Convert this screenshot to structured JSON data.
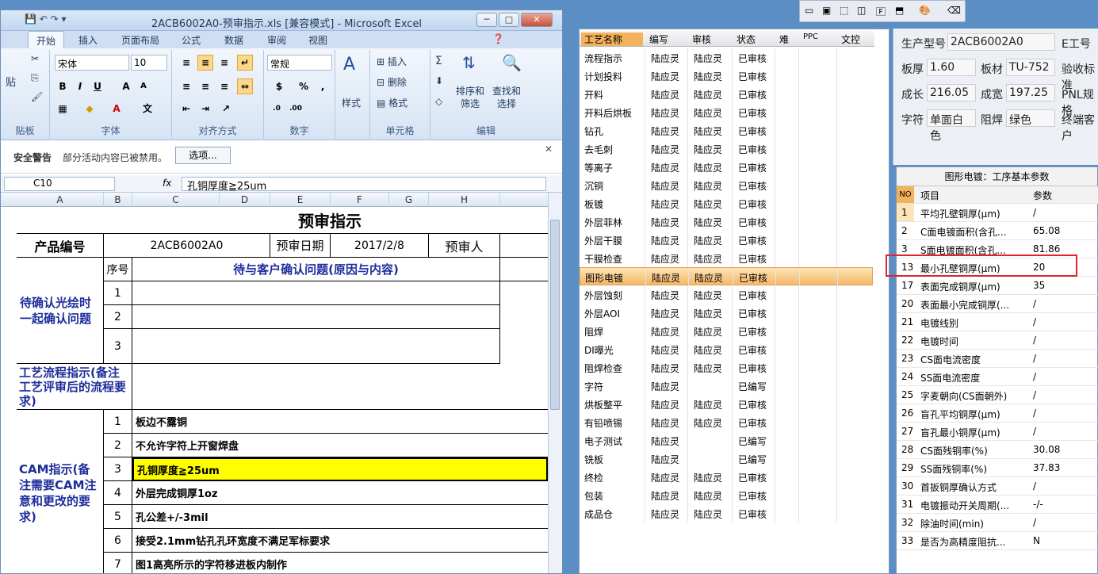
{
  "excel": {
    "title": "2ACB6002A0-预审指示.xls  [兼容模式] - Microsoft Excel",
    "tabs": [
      "开始",
      "插入",
      "页面布局",
      "公式",
      "数据",
      "审阅",
      "视图"
    ],
    "ribbon": {
      "font_name": "宋体",
      "font_size": "10",
      "number_format": "常规",
      "paste": "贴",
      "group_clipboard": "贴板",
      "group_font": "字体",
      "group_align": "对齐方式",
      "group_number": "数字",
      "styles": "样式",
      "insert": "插入",
      "delete": "删除",
      "format": "格式",
      "group_cells": "单元格",
      "sort_filter": "排序和\n筛选",
      "find_select": "查找和\n选择",
      "group_edit": "编辑"
    },
    "security": {
      "title": "安全警告",
      "message": "部分活动内容已被禁用。",
      "options": "选项..."
    },
    "formula": {
      "cell_ref": "C10",
      "fx": "fx",
      "content": "孔铜厚度≧25um"
    },
    "columns": [
      "A",
      "B",
      "C",
      "D",
      "E",
      "F",
      "G",
      "H"
    ],
    "sheet": {
      "title": "预审指示",
      "product_no_label": "产品编号",
      "product_no": "2ACB6002A0",
      "review_date_label": "预审日期",
      "review_date": "2017/2/8",
      "reviewer_label": "预审人",
      "seq_label": "序号",
      "pending_header": "待与客户确认问题(原因与内容)",
      "pending_label": "待确认光绘时一起确认问题",
      "pending_rows": [
        "1",
        "2",
        "3"
      ],
      "process_label": "工艺流程指示(备注工艺评审后的流程要求)",
      "cam_label": "CAM指示(备注需要CAM注意和更改的要求)",
      "cam_rows": [
        {
          "no": "1",
          "text": "板边不露铜"
        },
        {
          "no": "2",
          "text": "不允许字符上开窗焊盘"
        },
        {
          "no": "3",
          "text": "孔铜厚度≧25um"
        },
        {
          "no": "4",
          "text": "外层完成铜厚1oz"
        },
        {
          "no": "5",
          "text": "孔公差+/-3mil"
        },
        {
          "no": "6",
          "text": "接受2.1mm钻孔孔环宽度不满足军标要求"
        },
        {
          "no": "7",
          "text": "图1高亮所示的字符移进板内制作"
        }
      ]
    }
  },
  "process_list": {
    "headers": [
      "工艺名称",
      "编写",
      "审核",
      "状态",
      "难",
      "PPC",
      "文控"
    ],
    "rows": [
      {
        "name": "流程指示",
        "writer": "陆应灵",
        "reviewer": "陆应灵",
        "status": "已审核"
      },
      {
        "name": "计划投料",
        "writer": "陆应灵",
        "reviewer": "陆应灵",
        "status": "已审核"
      },
      {
        "name": "开料",
        "writer": "陆应灵",
        "reviewer": "陆应灵",
        "status": "已审核"
      },
      {
        "name": "开料后烘板",
        "writer": "陆应灵",
        "reviewer": "陆应灵",
        "status": "已审核"
      },
      {
        "name": "钻孔",
        "writer": "陆应灵",
        "reviewer": "陆应灵",
        "status": "已审核"
      },
      {
        "name": "去毛刺",
        "writer": "陆应灵",
        "reviewer": "陆应灵",
        "status": "已审核"
      },
      {
        "name": "等离子",
        "writer": "陆应灵",
        "reviewer": "陆应灵",
        "status": "已审核"
      },
      {
        "name": "沉铜",
        "writer": "陆应灵",
        "reviewer": "陆应灵",
        "status": "已审核"
      },
      {
        "name": "板镀",
        "writer": "陆应灵",
        "reviewer": "陆应灵",
        "status": "已审核"
      },
      {
        "name": "外层菲林",
        "writer": "陆应灵",
        "reviewer": "陆应灵",
        "status": "已审核"
      },
      {
        "name": "外层干膜",
        "writer": "陆应灵",
        "reviewer": "陆应灵",
        "status": "已审核"
      },
      {
        "name": "干膜检查",
        "writer": "陆应灵",
        "reviewer": "陆应灵",
        "status": "已审核"
      },
      {
        "name": "图形电镀",
        "writer": "陆应灵",
        "reviewer": "陆应灵",
        "status": "已审核"
      },
      {
        "name": "外层蚀刻",
        "writer": "陆应灵",
        "reviewer": "陆应灵",
        "status": "已审核"
      },
      {
        "name": "外层AOI",
        "writer": "陆应灵",
        "reviewer": "陆应灵",
        "status": "已审核"
      },
      {
        "name": "阻焊",
        "writer": "陆应灵",
        "reviewer": "陆应灵",
        "status": "已审核"
      },
      {
        "name": "DI曝光",
        "writer": "陆应灵",
        "reviewer": "陆应灵",
        "status": "已审核"
      },
      {
        "name": "阻焊检查",
        "writer": "陆应灵",
        "reviewer": "陆应灵",
        "status": "已审核"
      },
      {
        "name": "字符",
        "writer": "陆应灵",
        "reviewer": "",
        "status": "已编写"
      },
      {
        "name": "烘板整平",
        "writer": "陆应灵",
        "reviewer": "陆应灵",
        "status": "已审核"
      },
      {
        "name": "有铅喷锡",
        "writer": "陆应灵",
        "reviewer": "陆应灵",
        "status": "已审核"
      },
      {
        "name": "电子测试",
        "writer": "陆应灵",
        "reviewer": "",
        "status": "已编写"
      },
      {
        "name": "铣板",
        "writer": "陆应灵",
        "reviewer": "",
        "status": "已编写"
      },
      {
        "name": "终检",
        "writer": "陆应灵",
        "reviewer": "陆应灵",
        "status": "已审核"
      },
      {
        "name": "包装",
        "writer": "陆应灵",
        "reviewer": "陆应灵",
        "status": "已审核"
      },
      {
        "name": "成品仓",
        "writer": "陆应灵",
        "reviewer": "陆应灵",
        "status": "已审核"
      }
    ]
  },
  "info": {
    "model_label": "生产型号",
    "model": "2ACB6002A0",
    "eno_label": "E工号",
    "thickness_label": "板厚",
    "thickness": "1.60",
    "material_label": "板材",
    "material": "TU-752",
    "accept_label": "验收标准",
    "length_label": "成长",
    "length": "216.05",
    "width_label": "成宽",
    "width": "197.25",
    "pnl_label": "PNL规格",
    "char_label": "字符",
    "char": "单面白色",
    "mask_label": "阻焊",
    "mask": "绿色",
    "terminal_label": "终端客户"
  },
  "params": {
    "title": "图形电镀：工序基本参数",
    "headers": [
      "NO",
      "项目",
      "参数"
    ],
    "rows": [
      {
        "no": "1",
        "item": "平均孔壁铜厚(μm)",
        "value": "/"
      },
      {
        "no": "2",
        "item": "C面电镀面积(含孔...",
        "value": "65.08"
      },
      {
        "no": "3",
        "item": "S面电镀面积(含孔...",
        "value": "81.86"
      },
      {
        "no": "13",
        "item": "最小孔壁铜厚(μm)",
        "value": "20"
      },
      {
        "no": "17",
        "item": "表面完成铜厚(μm)",
        "value": "35"
      },
      {
        "no": "20",
        "item": "表面最小完成铜厚(...",
        "value": "/"
      },
      {
        "no": "21",
        "item": "电镀线别",
        "value": "/"
      },
      {
        "no": "22",
        "item": "电镀时间",
        "value": "/"
      },
      {
        "no": "23",
        "item": "CS面电流密度",
        "value": "/"
      },
      {
        "no": "24",
        "item": "SS面电流密度",
        "value": "/"
      },
      {
        "no": "25",
        "item": "字麦朝向(CS面朝外)",
        "value": "/"
      },
      {
        "no": "26",
        "item": "盲孔平均铜厚(μm)",
        "value": "/"
      },
      {
        "no": "27",
        "item": "盲孔最小铜厚(μm)",
        "value": "/"
      },
      {
        "no": "28",
        "item": "CS面残铜率(%)",
        "value": "30.08"
      },
      {
        "no": "29",
        "item": "SS面残铜率(%)",
        "value": "37.83"
      },
      {
        "no": "30",
        "item": "首扳铜厚确认方式",
        "value": "/"
      },
      {
        "no": "31",
        "item": "电镀振动开关周期(...",
        "value": "-/-"
      },
      {
        "no": "32",
        "item": "除油时间(min)",
        "value": "/"
      },
      {
        "no": "33",
        "item": "是否为高精度阻抗...",
        "value": "N"
      }
    ]
  }
}
